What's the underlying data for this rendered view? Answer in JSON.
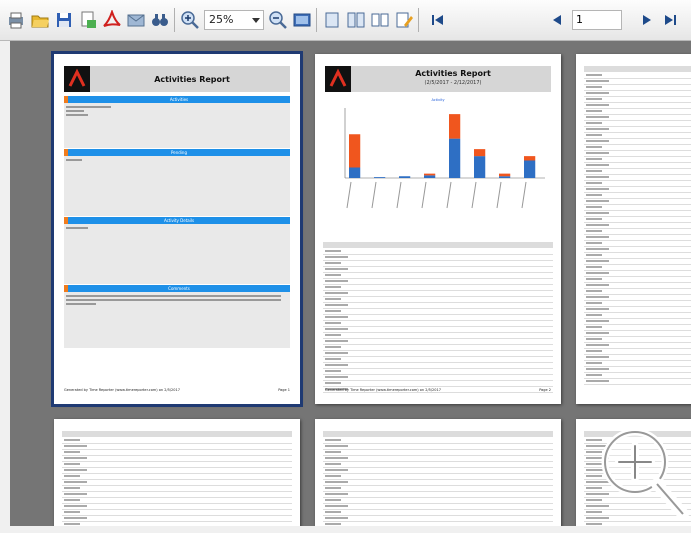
{
  "toolbar": {
    "zoom_value": "25%",
    "page_value": "1"
  },
  "pages": {
    "p1": {
      "title": "Activities Report",
      "sections": [
        "Activities",
        "Pending",
        "Activity Details",
        "Comments"
      ],
      "footer_left": "Generated by Time Reporter (www.timereporter.com) on 2/5/2017",
      "footer_right": "Page 1"
    },
    "p2": {
      "title": "Activities Report",
      "subtitle": "(2/5/2017 - 2/12/2017)",
      "chart_caption": "Activity",
      "footer_left": "Generated by Time Reporter (www.timereporter.com) on 2/5/2017",
      "footer_right": "Page 2"
    }
  },
  "chart_data": {
    "type": "bar",
    "series": [
      {
        "name": "",
        "color": "#2e6fc4",
        "values": [
          12,
          1,
          2,
          3,
          45,
          25,
          2,
          20
        ]
      },
      {
        "name": "",
        "color": "#f0561e",
        "values": [
          38,
          0,
          0,
          2,
          28,
          8,
          3,
          5
        ]
      }
    ],
    "stacked": true,
    "ylim": [
      0,
      80
    ]
  },
  "colors": {
    "accent_blue": "#1e90e8",
    "accent_orange": "#f07c1e",
    "viewer_bg": "#757575",
    "selected_border": "#1f3a73"
  }
}
